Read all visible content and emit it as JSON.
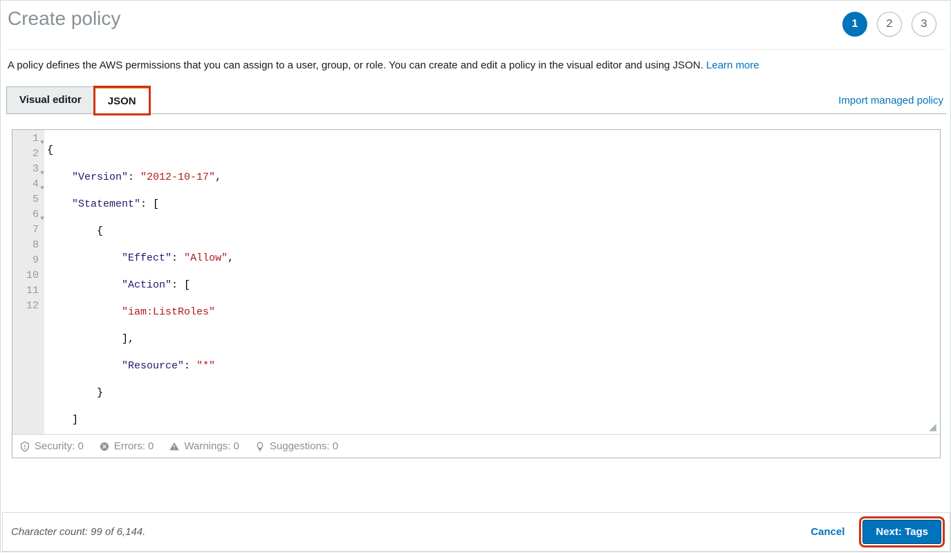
{
  "title": "Create policy",
  "steps": {
    "s1": "1",
    "s2": "2",
    "s3": "3"
  },
  "description_text": "A policy defines the AWS permissions that you can assign to a user, group, or role. You can create and edit a policy in the visual editor and using JSON. ",
  "learn_more": "Learn more",
  "tabs": {
    "visual": "Visual editor",
    "json": "JSON"
  },
  "import_link": "Import managed policy",
  "gutter": [
    "1",
    "2",
    "3",
    "4",
    "5",
    "6",
    "7",
    "8",
    "9",
    "10",
    "11",
    "12"
  ],
  "code": {
    "l1_brace": "{",
    "l2_key": "\"Version\"",
    "l2_val": "\"2012-10-17\"",
    "l3_key": "\"Statement\"",
    "l4_brace": "{",
    "l5_key": "\"Effect\"",
    "l5_val": "\"Allow\"",
    "l6_key": "\"Action\"",
    "l7_val": "\"iam:ListRoles\"",
    "l9_key": "\"Resource\"",
    "l9_val": "\"*\"",
    "l10_brace": "}",
    "l12_brace": "}"
  },
  "status": {
    "security": "Security: 0",
    "errors": "Errors: 0",
    "warnings": "Warnings: 0",
    "suggestions": "Suggestions: 0"
  },
  "char_count": "Character count: 99 of 6,144.",
  "cancel": "Cancel",
  "next": "Next: Tags"
}
